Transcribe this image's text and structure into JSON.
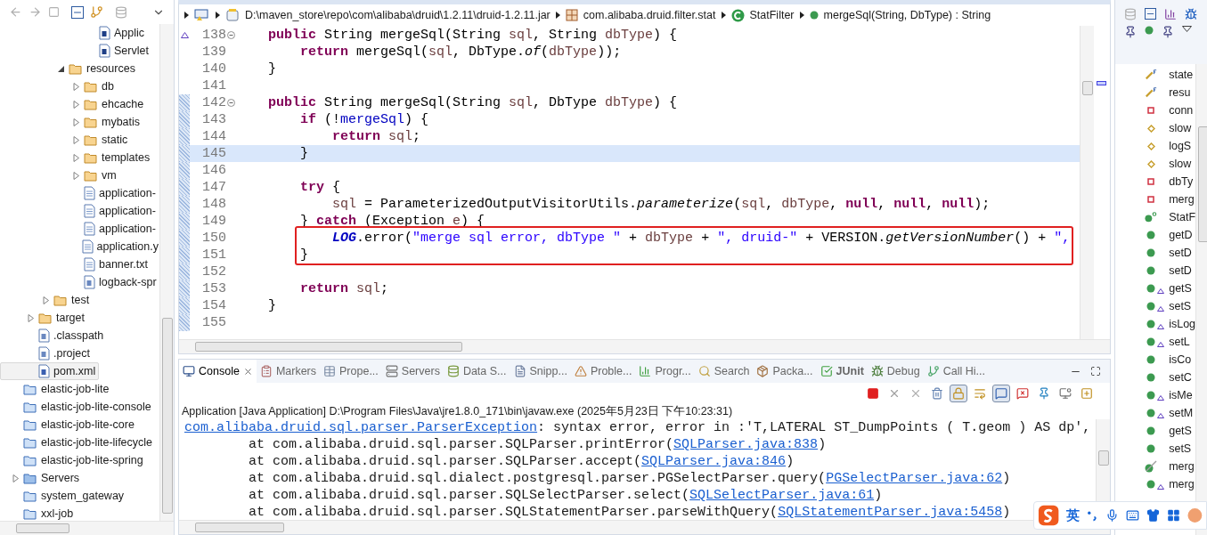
{
  "explorer": {
    "tree": [
      {
        "children": [
          {
            "children": [
              {
                "children": [
                  {
                    "children": [
                      {
                        "children": [
                          {
                            "label": "Applic",
                            "kind": "java",
                            "selected": false
                          },
                          {
                            "label": "Servlet",
                            "kind": "java",
                            "selected": false
                          }
                        ]
                      }
                    ]
                  },
                  {
                    "label": "resources",
                    "kind": "folder",
                    "expanded": true,
                    "selected": false,
                    "children": [
                      {
                        "label": "db",
                        "kind": "folder",
                        "expanded": false,
                        "selected": false
                      },
                      {
                        "label": "ehcache",
                        "kind": "folder",
                        "expanded": false,
                        "selected": false
                      },
                      {
                        "label": "mybatis",
                        "kind": "folder",
                        "expanded": false,
                        "selected": false
                      },
                      {
                        "label": "static",
                        "kind": "folder",
                        "expanded": false,
                        "selected": false
                      },
                      {
                        "label": "templates",
                        "kind": "folder",
                        "expanded": false,
                        "selected": false
                      },
                      {
                        "label": "vm",
                        "kind": "folder",
                        "expanded": false,
                        "selected": false
                      },
                      {
                        "label": "application-",
                        "kind": "text",
                        "selected": false
                      },
                      {
                        "label": "application-",
                        "kind": "text",
                        "selected": false
                      },
                      {
                        "label": "application-",
                        "kind": "text",
                        "selected": false
                      },
                      {
                        "label": "application.y",
                        "kind": "text",
                        "selected": false
                      },
                      {
                        "label": "banner.txt",
                        "kind": "text",
                        "selected": false
                      },
                      {
                        "label": "logback-spr",
                        "kind": "xml",
                        "selected": false
                      }
                    ]
                  }
                ]
              },
              {
                "label": "test",
                "kind": "folder",
                "expanded": false,
                "selected": false
              }
            ]
          },
          {
            "label": "target",
            "kind": "folder",
            "expanded": false,
            "selected": false
          },
          {
            "label": ".classpath",
            "kind": "xml",
            "selected": false
          },
          {
            "label": ".project",
            "kind": "xml",
            "selected": false
          },
          {
            "label": "pom.xml",
            "kind": "maven",
            "selected": true
          }
        ]
      },
      {
        "label": "elastic-job-lite",
        "kind": "project",
        "selected": false
      },
      {
        "label": "elastic-job-lite-console",
        "kind": "project",
        "selected": false
      },
      {
        "label": "elastic-job-lite-core",
        "kind": "project",
        "selected": false
      },
      {
        "label": "elastic-job-lite-lifecycle",
        "kind": "project",
        "selected": false
      },
      {
        "label": "elastic-job-lite-spring",
        "kind": "project",
        "selected": false
      },
      {
        "label": "Servers",
        "kind": "servers",
        "expanded": false,
        "selected": false
      },
      {
        "label": "system_gateway",
        "kind": "project",
        "selected": false
      },
      {
        "label": "xxl-job",
        "kind": "project",
        "selected": false
      }
    ]
  },
  "editor": {
    "breadcrumb": [
      {
        "kind": "maven-project"
      },
      {
        "kind": "jar",
        "text": "D:\\maven_store\\repo\\com\\alibaba\\druid\\1.2.11\\druid-1.2.11.jar"
      },
      {
        "kind": "package",
        "text": "com.alibaba.druid.filter.stat"
      },
      {
        "kind": "class",
        "text": "StatFilter"
      },
      {
        "kind": "method",
        "text": "mergeSql(String, DbType) : String"
      }
    ],
    "lines": [
      {
        "number": "138",
        "changed": false,
        "fold": true,
        "override": true,
        "current": false,
        "boxed": false,
        "tokens": [
          {
            "text": "    public",
            "kind": "keyword"
          },
          {
            "text": " String mergeSql(String "
          },
          {
            "text": "sql",
            "kind": "param"
          },
          {
            "text": ", String "
          },
          {
            "text": "dbType",
            "kind": "param"
          },
          {
            "text": ") {"
          }
        ]
      },
      {
        "number": "139",
        "changed": false,
        "fold": false,
        "override": false,
        "current": false,
        "boxed": false,
        "tokens": [
          {
            "text": "        return",
            "kind": "keyword"
          },
          {
            "text": " mergeSql("
          },
          {
            "text": "sql",
            "kind": "param"
          },
          {
            "text": ", DbType."
          },
          {
            "text": "of",
            "kind": "static-method"
          },
          {
            "text": "("
          },
          {
            "text": "dbType",
            "kind": "param"
          },
          {
            "text": "));"
          }
        ]
      },
      {
        "number": "140",
        "changed": false,
        "fold": false,
        "override": false,
        "current": false,
        "boxed": false,
        "tokens": [
          {
            "text": "    }"
          }
        ]
      },
      {
        "number": "141",
        "changed": false,
        "fold": false,
        "override": false,
        "current": false,
        "boxed": false
      },
      {
        "number": "142",
        "changed": true,
        "fold": true,
        "override": false,
        "current": false,
        "boxed": false,
        "tokens": [
          {
            "text": "    public",
            "kind": "keyword"
          },
          {
            "text": " String mergeSql(String "
          },
          {
            "text": "sql",
            "kind": "param"
          },
          {
            "text": ", DbType "
          },
          {
            "text": "dbType",
            "kind": "param"
          },
          {
            "text": ") {"
          }
        ]
      },
      {
        "number": "143",
        "changed": true,
        "fold": false,
        "override": false,
        "current": false,
        "boxed": false,
        "tokens": [
          {
            "text": "        if",
            "kind": "keyword"
          },
          {
            "text": " (!"
          },
          {
            "text": "mergeSql",
            "kind": "field"
          },
          {
            "text": ") {"
          }
        ]
      },
      {
        "number": "144",
        "changed": true,
        "fold": false,
        "override": false,
        "current": false,
        "boxed": false,
        "tokens": [
          {
            "text": "            return ",
            "kind": "keyword"
          },
          {
            "text": "sql",
            "kind": "param"
          },
          {
            "text": ";"
          }
        ]
      },
      {
        "number": "145",
        "changed": true,
        "fold": false,
        "override": false,
        "current": true,
        "boxed": false,
        "tokens": [
          {
            "text": "        }"
          }
        ]
      },
      {
        "number": "146",
        "changed": true,
        "fold": false,
        "override": false,
        "current": false,
        "boxed": false
      },
      {
        "number": "147",
        "changed": true,
        "fold": false,
        "override": false,
        "current": false,
        "boxed": false,
        "tokens": [
          {
            "text": "        try",
            "kind": "keyword"
          },
          {
            "text": " {"
          }
        ]
      },
      {
        "number": "148",
        "changed": true,
        "fold": false,
        "override": false,
        "current": false,
        "boxed": false,
        "tokens": [
          {
            "text": "            sql",
            "kind": "param"
          },
          {
            "text": " = ParameterizedOutputVisitorUtils."
          },
          {
            "text": "parameterize",
            "kind": "static-method"
          },
          {
            "text": "("
          },
          {
            "text": "sql",
            "kind": "param"
          },
          {
            "text": ", "
          },
          {
            "text": "dbType",
            "kind": "param"
          },
          {
            "text": ", "
          },
          {
            "text": "null",
            "kind": "keyword"
          },
          {
            "text": ", "
          },
          {
            "text": "null",
            "kind": "keyword"
          },
          {
            "text": ", "
          },
          {
            "text": "null",
            "kind": "keyword"
          },
          {
            "text": ");"
          }
        ]
      },
      {
        "number": "149",
        "changed": true,
        "fold": false,
        "override": false,
        "current": false,
        "boxed": false,
        "tokens": [
          {
            "text": "        } "
          },
          {
            "text": "catch",
            "kind": "keyword"
          },
          {
            "text": " (Exception "
          },
          {
            "text": "e",
            "kind": "param"
          },
          {
            "text": ") {"
          }
        ]
      },
      {
        "number": "150",
        "changed": true,
        "fold": false,
        "override": false,
        "current": false,
        "boxed": true,
        "tokens": [
          {
            "text": "            LOG",
            "kind": "static-field"
          },
          {
            "text": ".error("
          },
          {
            "text": "\"merge sql error, dbType \"",
            "kind": "string"
          },
          {
            "text": " + "
          },
          {
            "text": "dbType",
            "kind": "param"
          },
          {
            "text": " + "
          },
          {
            "text": "\", druid-\"",
            "kind": "string"
          },
          {
            "text": " + VERSION."
          },
          {
            "text": "getVersionNumber",
            "kind": "static-method"
          },
          {
            "text": "() + "
          },
          {
            "text": "\", ",
            "kind": "string"
          }
        ]
      },
      {
        "number": "151",
        "changed": true,
        "fold": false,
        "override": false,
        "current": false,
        "boxed": true,
        "tokens": [
          {
            "text": "        }"
          }
        ]
      },
      {
        "number": "152",
        "changed": true,
        "fold": false,
        "override": false,
        "current": false,
        "boxed": false
      },
      {
        "number": "153",
        "changed": true,
        "fold": false,
        "override": false,
        "current": false,
        "boxed": false,
        "tokens": [
          {
            "text": "        return ",
            "kind": "keyword"
          },
          {
            "text": "sql",
            "kind": "param"
          },
          {
            "text": ";"
          }
        ]
      },
      {
        "number": "154",
        "changed": true,
        "fold": false,
        "override": false,
        "current": false,
        "boxed": false,
        "tokens": [
          {
            "text": "    }"
          }
        ]
      },
      {
        "number": "155",
        "changed": true,
        "fold": false,
        "override": false,
        "current": false,
        "boxed": false
      }
    ]
  },
  "console": {
    "tabs": [
      {
        "label": "Console",
        "kind": "console",
        "selected": true,
        "bold": false
      },
      {
        "label": "Markers",
        "kind": "markers",
        "selected": false,
        "bold": false
      },
      {
        "label": "Prope...",
        "kind": "properties",
        "selected": false,
        "bold": false
      },
      {
        "label": "Servers",
        "kind": "servers",
        "selected": false,
        "bold": false
      },
      {
        "label": "Data S...",
        "kind": "data",
        "selected": false,
        "bold": false
      },
      {
        "label": "Snipp...",
        "kind": "snippets",
        "selected": false,
        "bold": false
      },
      {
        "label": "Proble...",
        "kind": "problems",
        "selected": false,
        "bold": false
      },
      {
        "label": "Progr...",
        "kind": "progress",
        "selected": false,
        "bold": false
      },
      {
        "label": "Search",
        "kind": "search",
        "selected": false,
        "bold": false
      },
      {
        "label": "Packa...",
        "kind": "package",
        "selected": false,
        "bold": false
      },
      {
        "label": "JUnit",
        "kind": "junit",
        "selected": false,
        "bold": true
      },
      {
        "label": "Debug",
        "kind": "debug",
        "selected": false,
        "bold": false
      },
      {
        "label": "Call Hi...",
        "kind": "call",
        "selected": false,
        "bold": false
      }
    ],
    "toolbar": [
      {
        "kind": "terminate",
        "pressed": false
      },
      {
        "kind": "remove",
        "pressed": false
      },
      {
        "kind": "remove-all",
        "pressed": false
      },
      {
        "kind": "clear",
        "pressed": false
      },
      {
        "kind": "scroll-lock",
        "pressed": true
      },
      {
        "kind": "word-wrap",
        "pressed": false
      },
      {
        "kind": "show-output",
        "pressed": true
      },
      {
        "kind": "show-error",
        "pressed": false
      },
      {
        "kind": "pin",
        "pressed": false
      },
      {
        "kind": "display",
        "pressed": false
      },
      {
        "kind": "open",
        "pressed": false
      }
    ],
    "process": "Application [Java Application] D:\\Program Files\\Java\\jre1.8.0_171\\bin\\javaw.exe (2025年5月23日 下午10:23:31)",
    "lines": [
      [
        {
          "text": "com.alibaba.druid.sql.parser.ParserException",
          "link": true
        },
        {
          "text": ": syntax error, error in :'T,LATERAL ST_DumpPoints ( T.geom ) AS dp',",
          "link": false
        }
      ],
      [
        {
          "text": "\tat com.alibaba.druid.sql.parser.SQLParser.printError(",
          "link": false
        },
        {
          "text": "SQLParser.java:838",
          "link": true
        },
        {
          "text": ")",
          "link": false
        }
      ],
      [
        {
          "text": "\tat com.alibaba.druid.sql.parser.SQLParser.accept(",
          "link": false
        },
        {
          "text": "SQLParser.java:846",
          "link": true
        },
        {
          "text": ")",
          "link": false
        }
      ],
      [
        {
          "text": "\tat com.alibaba.druid.sql.dialect.postgresql.parser.PGSelectParser.query(",
          "link": false
        },
        {
          "text": "PGSelectParser.java:62",
          "link": true
        },
        {
          "text": ")",
          "link": false
        }
      ],
      [
        {
          "text": "\tat com.alibaba.druid.sql.parser.SQLSelectParser.select(",
          "link": false
        },
        {
          "text": "SQLSelectParser.java:61",
          "link": true
        },
        {
          "text": ")",
          "link": false
        }
      ],
      [
        {
          "text": "\tat com.alibaba.druid.sql.parser.SQLStatementParser.parseWithQuery(",
          "link": false
        },
        {
          "text": "SQLStatementParser.java:5458",
          "link": true
        },
        {
          "text": ")",
          "link": false
        }
      ]
    ]
  },
  "outline": {
    "items": [
      {
        "label": "state",
        "kind": "final-field",
        "overrides": false
      },
      {
        "label": "resu",
        "kind": "final-field",
        "overrides": false
      },
      {
        "label": "conn",
        "kind": "private-field",
        "overrides": false
      },
      {
        "label": "slow",
        "kind": "default-field",
        "overrides": false
      },
      {
        "label": "logS",
        "kind": "default-field",
        "overrides": false
      },
      {
        "label": "slow",
        "kind": "default-field",
        "overrides": false
      },
      {
        "label": "dbTy",
        "kind": "private-field",
        "overrides": false
      },
      {
        "label": "merg",
        "kind": "private-field",
        "overrides": false
      },
      {
        "label": "StatF",
        "kind": "constructor",
        "overrides": false
      },
      {
        "label": "getD",
        "kind": "method",
        "overrides": false
      },
      {
        "label": "setD",
        "kind": "method",
        "overrides": false
      },
      {
        "label": "setD",
        "kind": "method",
        "overrides": false
      },
      {
        "label": "getS",
        "kind": "method",
        "overrides": true
      },
      {
        "label": "setS",
        "kind": "method",
        "overrides": true
      },
      {
        "label": "isLog",
        "kind": "method",
        "overrides": true
      },
      {
        "label": "setL",
        "kind": "method",
        "overrides": true
      },
      {
        "label": "isCo",
        "kind": "method",
        "overrides": false
      },
      {
        "label": "setC",
        "kind": "method",
        "overrides": false
      },
      {
        "label": "isMe",
        "kind": "method",
        "overrides": true
      },
      {
        "label": "setM",
        "kind": "method",
        "overrides": true
      },
      {
        "label": "getS",
        "kind": "method",
        "overrides": false
      },
      {
        "label": "setS",
        "kind": "method",
        "overrides": false
      },
      {
        "label": "merg",
        "kind": "struck-method",
        "overrides": false
      },
      {
        "label": "merg",
        "kind": "method",
        "overrides": true
      }
    ]
  },
  "ime_bar": {
    "mode": "英"
  }
}
